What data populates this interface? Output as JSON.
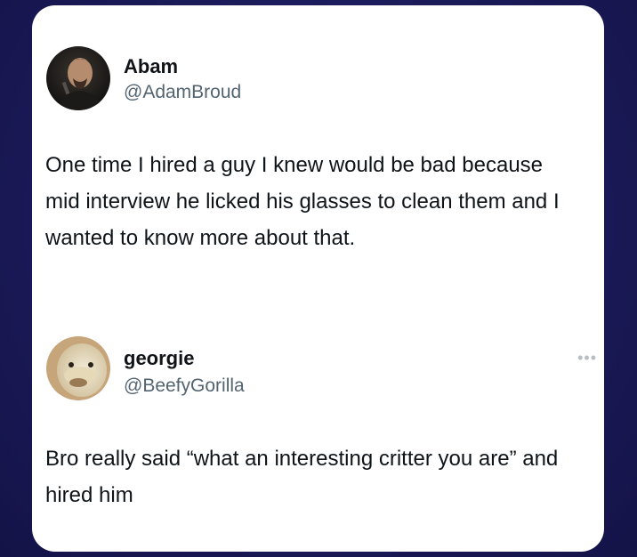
{
  "posts": [
    {
      "name": "Abam",
      "handle": "@AdamBroud",
      "text": "One time I hired a guy I knew would be bad because mid interview he licked his glasses to clean them and I wanted to know more about that."
    },
    {
      "name": "georgie",
      "handle": "@BeefyGorilla",
      "text": "Bro really said “what an interesting critter you are” and hired him",
      "more_icon": "•••"
    }
  ]
}
